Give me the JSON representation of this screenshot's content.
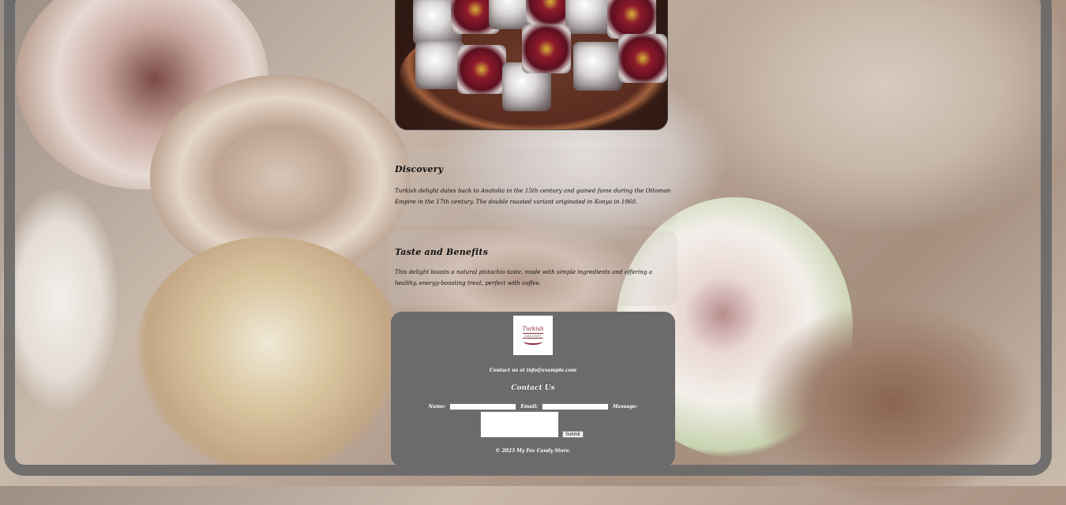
{
  "sections": {
    "discovery": {
      "title": "Discovery",
      "text": "Turkish delight dates back to Anatolia in the 15th century and gained fame during the Ottoman Empire in the 17th century. The double roasted variant originated in Konya in 1960."
    },
    "taste": {
      "title": "Taste and Benefits",
      "text": "This delight boasts a natural pistachio taste, made with simple ingredients and offering a healthy, energy-boosting treat, perfect with coffee."
    }
  },
  "footer": {
    "logo_text": "Turkish Delight",
    "contact_line": "Contact us at info@example.com",
    "contact_title": "Contact Us",
    "form": {
      "name_label": "Name:",
      "name_value": "",
      "email_label": "Email:",
      "email_value": "",
      "message_label": "Message:",
      "message_value": "",
      "submit_label": "Submit"
    },
    "copyright": "© 2023 My Fav Candy Store."
  },
  "colors": {
    "footer_bg": "#6b6b6b",
    "frame": "#696969",
    "logo_accent": "#8a2b3b"
  }
}
